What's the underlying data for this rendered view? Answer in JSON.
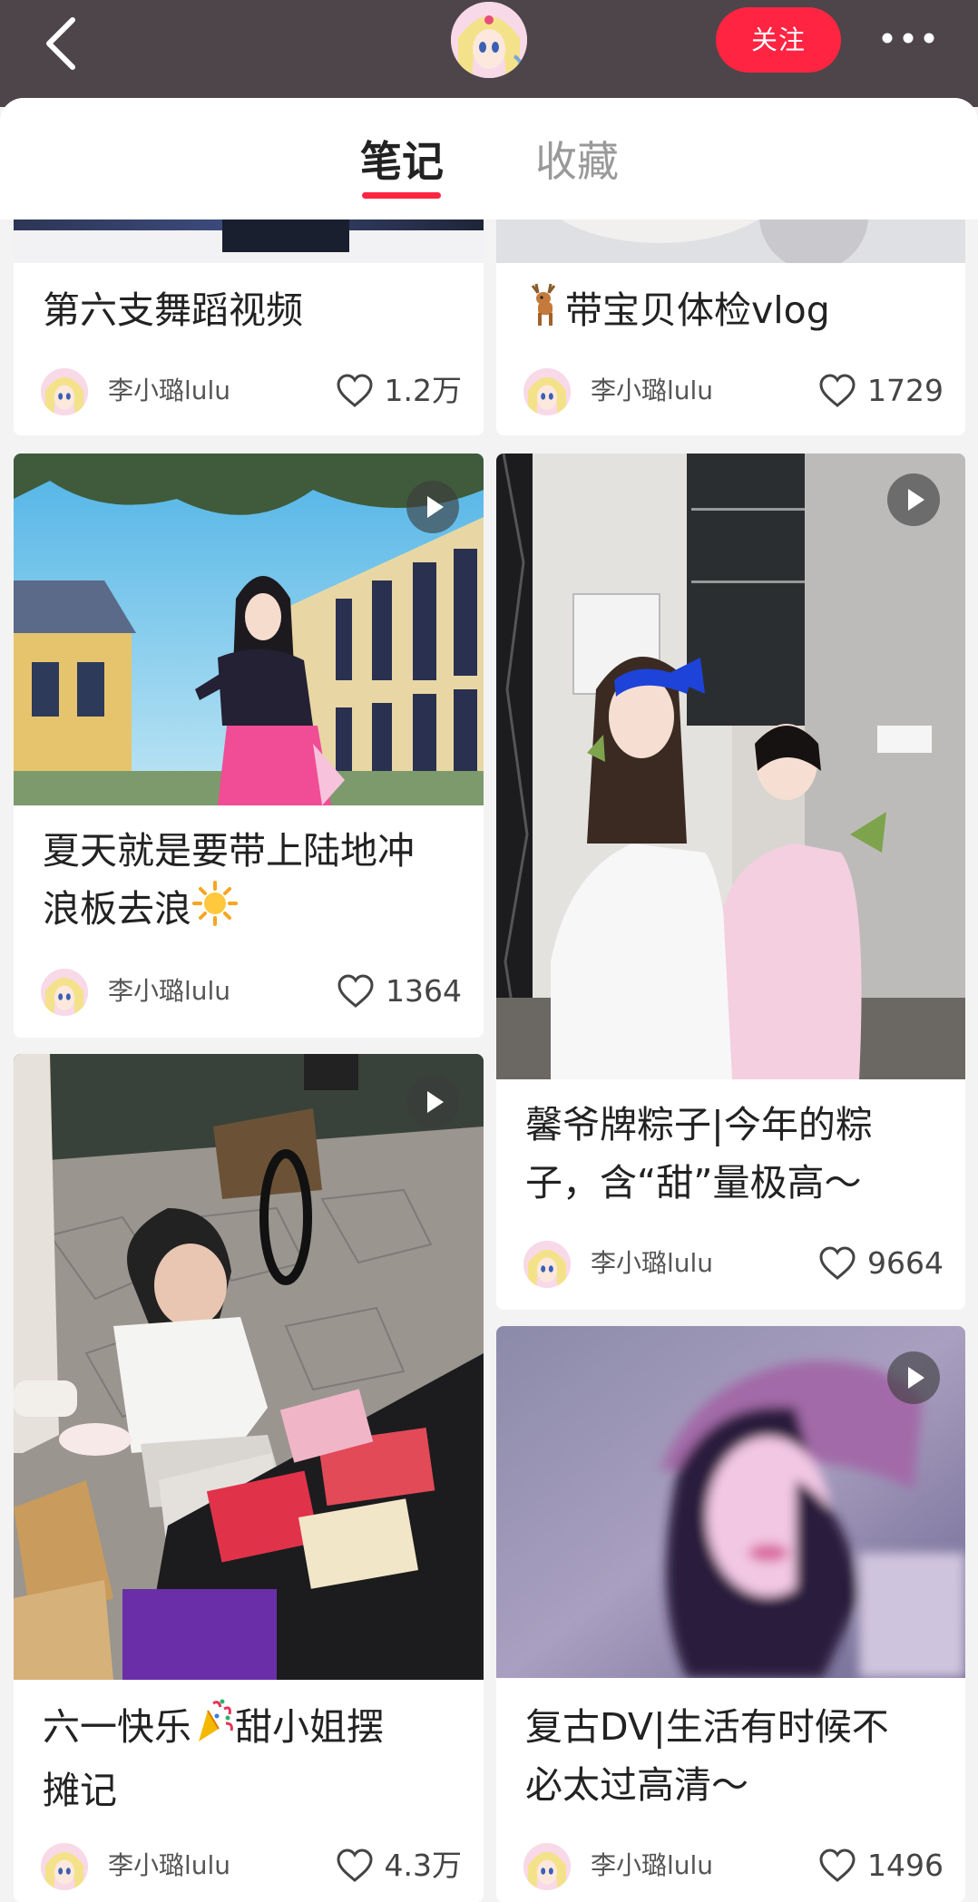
{
  "header": {
    "follow_label": "关注",
    "back_icon": "chevron-left-icon",
    "more_icon": "more-dots-icon"
  },
  "tabs": [
    {
      "label": "笔记",
      "active": true
    },
    {
      "label": "收藏",
      "active": false
    }
  ],
  "colors": {
    "accent": "#ff2442",
    "topbar": "#4d4549"
  },
  "cards": [
    {
      "title": "第六支舞蹈视频",
      "author": "李小璐lulu",
      "likes": "1.2万",
      "video": false
    },
    {
      "title": "带宝贝体检vlog",
      "title_emoji": "deer-emoji",
      "author": "李小璐lulu",
      "likes": "1729",
      "video": false
    },
    {
      "title_l1": "夏天就是要带上陆地冲",
      "title_l2": "浪板去浪",
      "title_emoji": "sun-emoji",
      "author": "李小璐lulu",
      "likes": "1364",
      "video": true
    },
    {
      "title_l1": "馨爷牌粽子|今年的粽",
      "title_l2": "子，含“甜”量极高～",
      "author": "李小璐lulu",
      "likes": "9664",
      "video": true
    },
    {
      "title_l1": "六一快乐",
      "title_l1b": "甜小姐摆",
      "title_l2": "摊记",
      "title_emoji": "confetti-emoji",
      "author": "李小璐lulu",
      "likes": "4.3万",
      "video": true
    },
    {
      "title_l1": "复古DV|生活有时候不",
      "title_l2": "必太过高清～",
      "author": "李小璐lulu",
      "likes": "1496",
      "video": true
    }
  ]
}
